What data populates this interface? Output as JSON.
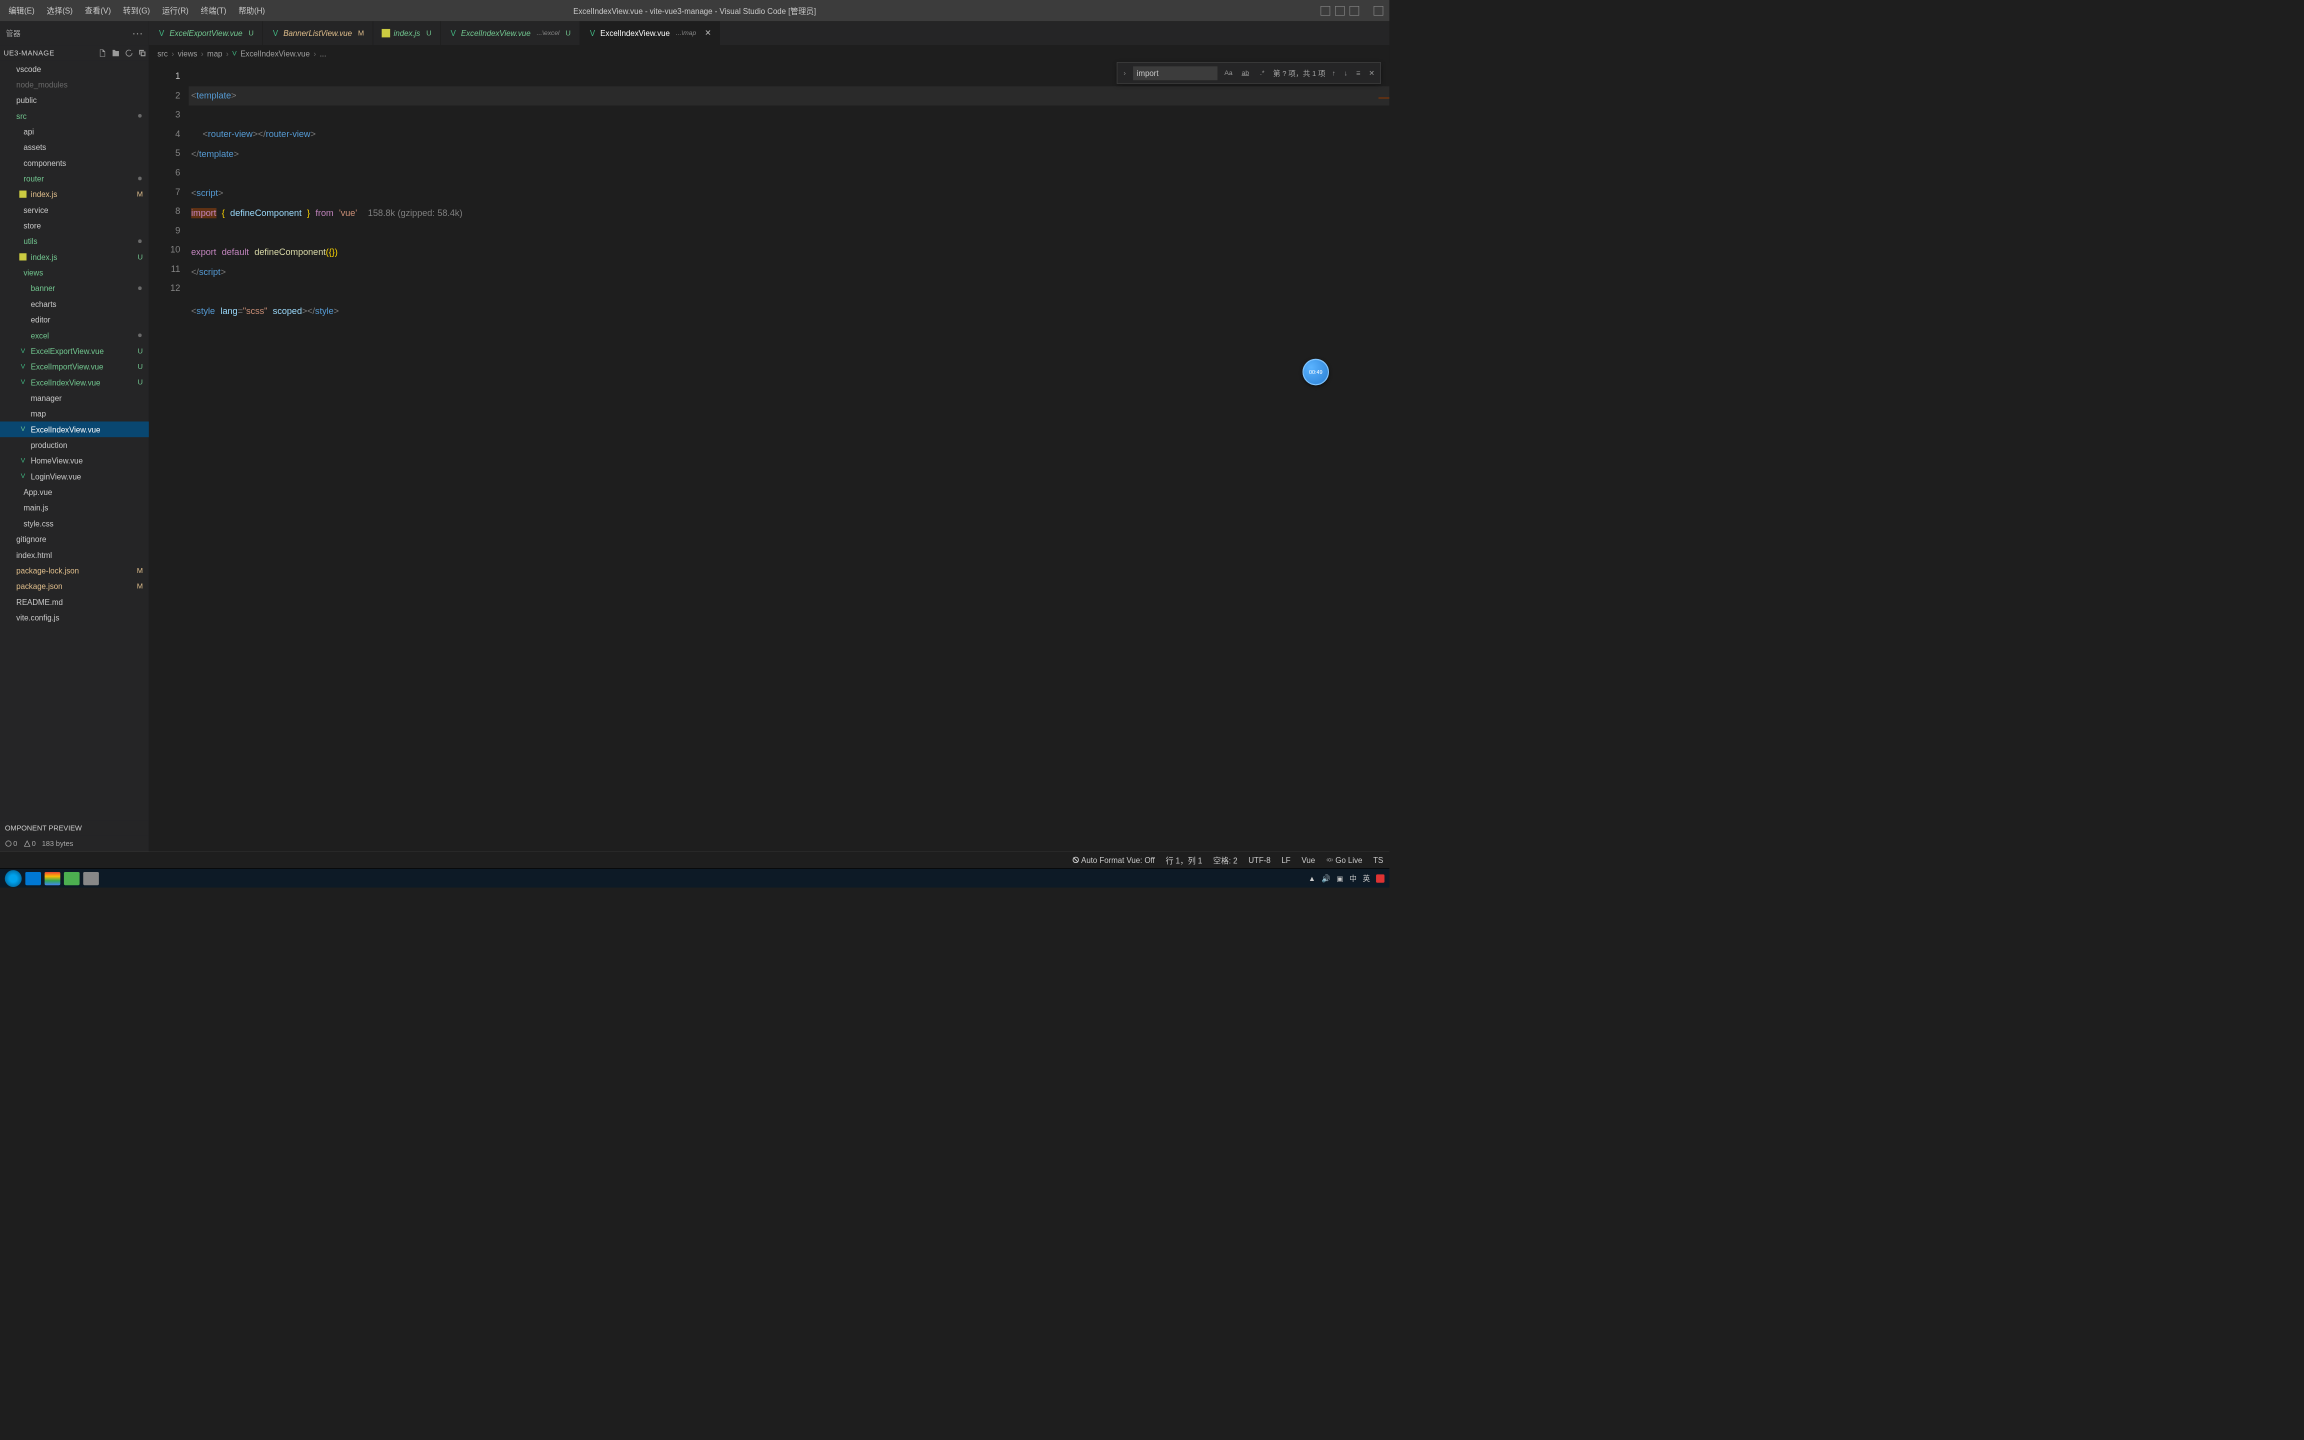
{
  "menu": [
    "编辑(E)",
    "选择(S)",
    "查看(V)",
    "转到(G)",
    "运行(R)",
    "终端(T)",
    "帮助(H)"
  ],
  "window_title": "ExcelIndexView.vue - vite-vue3-manage - Visual Studio Code [管理员]",
  "sidebar": {
    "tab_label": "管器",
    "project": "UE3-MANAGE",
    "preview_title": "OMPONENT PREVIEW",
    "preview_stat1": "0",
    "preview_stat2": "0",
    "preview_bytes": "183 bytes"
  },
  "tree": [
    {
      "label": "vscode",
      "indent": 0,
      "cls": ""
    },
    {
      "label": "node_modules",
      "indent": 0,
      "cls": "dim"
    },
    {
      "label": "public",
      "indent": 0,
      "cls": ""
    },
    {
      "label": "src",
      "indent": 0,
      "cls": "folder-green",
      "dot": true
    },
    {
      "label": "api",
      "indent": 1,
      "cls": ""
    },
    {
      "label": "assets",
      "indent": 1,
      "cls": ""
    },
    {
      "label": "components",
      "indent": 1,
      "cls": ""
    },
    {
      "label": "router",
      "indent": 1,
      "cls": "folder-green",
      "dot": true
    },
    {
      "label": "index.js",
      "indent": 2,
      "cls": "modified",
      "icon": "js",
      "badge": "M"
    },
    {
      "label": "service",
      "indent": 1,
      "cls": ""
    },
    {
      "label": "store",
      "indent": 1,
      "cls": ""
    },
    {
      "label": "utils",
      "indent": 1,
      "cls": "folder-green",
      "dot": true
    },
    {
      "label": "index.js",
      "indent": 2,
      "cls": "untracked",
      "icon": "js",
      "badge": "U"
    },
    {
      "label": "views",
      "indent": 1,
      "cls": "folder-green"
    },
    {
      "label": "banner",
      "indent": 2,
      "cls": "folder-green",
      "dot": true
    },
    {
      "label": "echarts",
      "indent": 2,
      "cls": ""
    },
    {
      "label": "editor",
      "indent": 2,
      "cls": ""
    },
    {
      "label": "excel",
      "indent": 2,
      "cls": "folder-green",
      "dot": true
    },
    {
      "label": "ExcelExportView.vue",
      "indent": 2,
      "cls": "untracked",
      "icon": "vue",
      "badge": "U"
    },
    {
      "label": "ExcelImportView.vue",
      "indent": 2,
      "cls": "untracked",
      "icon": "vue",
      "badge": "U"
    },
    {
      "label": "ExcelIndexView.vue",
      "indent": 2,
      "cls": "untracked",
      "icon": "vue",
      "badge": "U"
    },
    {
      "label": "manager",
      "indent": 2,
      "cls": ""
    },
    {
      "label": "map",
      "indent": 2,
      "cls": ""
    },
    {
      "label": "ExcelIndexView.vue",
      "indent": 2,
      "cls": "selected",
      "icon": "vue"
    },
    {
      "label": "production",
      "indent": 2,
      "cls": ""
    },
    {
      "label": "HomeView.vue",
      "indent": 2,
      "cls": "",
      "icon": "vue"
    },
    {
      "label": "LoginView.vue",
      "indent": 2,
      "cls": "",
      "icon": "vue"
    },
    {
      "label": "App.vue",
      "indent": 1,
      "cls": ""
    },
    {
      "label": "main.js",
      "indent": 1,
      "cls": ""
    },
    {
      "label": "style.css",
      "indent": 1,
      "cls": ""
    },
    {
      "label": "gitignore",
      "indent": 0,
      "cls": ""
    },
    {
      "label": "index.html",
      "indent": 0,
      "cls": ""
    },
    {
      "label": "package-lock.json",
      "indent": 0,
      "cls": "modified",
      "badge": "M"
    },
    {
      "label": "package.json",
      "indent": 0,
      "cls": "modified",
      "badge": "M"
    },
    {
      "label": "README.md",
      "indent": 0,
      "cls": ""
    },
    {
      "label": "vite.config.js",
      "indent": 0,
      "cls": ""
    }
  ],
  "tabs": [
    {
      "icon": "vue",
      "label": "ExcelExportView.vue",
      "status": "U",
      "statusColor": "#73c991",
      "labelColor": "#73c991"
    },
    {
      "icon": "vue",
      "label": "BannerListView.vue",
      "status": "M",
      "statusColor": "#e2c08d",
      "labelColor": "#e2c08d"
    },
    {
      "icon": "js",
      "label": "index.js",
      "status": "U",
      "statusColor": "#73c991",
      "labelColor": "#73c991"
    },
    {
      "icon": "vue",
      "label": "ExcelIndexView.vue",
      "desc": "...\\excel",
      "status": "U",
      "statusColor": "#73c991",
      "labelColor": "#73c991"
    },
    {
      "icon": "vue",
      "label": "ExcelIndexView.vue",
      "desc": "...\\map",
      "active": true,
      "close": true,
      "labelColor": "#ffffff"
    }
  ],
  "breadcrumbs": [
    "src",
    "views",
    "map",
    "ExcelIndexView.vue",
    "..."
  ],
  "code_lines": 12,
  "code": {
    "l1_tag_open": "<",
    "l1_template": "template",
    "l1_tag_close": ">",
    "l2_router": "router-view",
    "l3_close_template": "template",
    "l5_script": "script",
    "l6_import": "import",
    "l6_define": "defineComponent",
    "l6_from": "from",
    "l6_vue": "'vue'",
    "l6_hint": "158.8k (gzipped: 58.4k)",
    "l8_export": "export",
    "l8_default": "default",
    "l8_dc": "defineComponent",
    "l9_script_close": "script",
    "l11_style": "style",
    "l11_lang": "lang",
    "l11_scss": "\"scss\"",
    "l11_scoped": "scoped"
  },
  "find": {
    "value": "import",
    "result": "第 ? 项，共 1 项"
  },
  "statusbar": {
    "autoformat": "Auto Format Vue: Off",
    "pos": "行 1，列 1",
    "spaces": "空格: 2",
    "encoding": "UTF-8",
    "eol": "LF",
    "lang": "Vue",
    "golive": "Go Live",
    "ts": "TS"
  },
  "timer": "00:49",
  "tray": [
    "中",
    "英"
  ]
}
